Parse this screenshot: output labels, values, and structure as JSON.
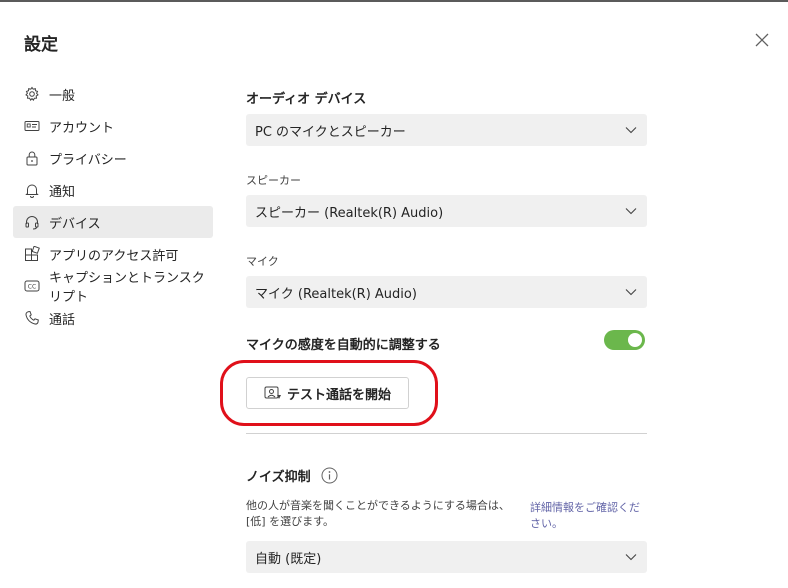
{
  "header": {
    "title": "設定"
  },
  "sidebar": {
    "items": [
      {
        "label": "一般",
        "icon": "gear-icon",
        "active": false
      },
      {
        "label": "アカウント",
        "icon": "id-card-icon",
        "active": false
      },
      {
        "label": "プライバシー",
        "icon": "lock-icon",
        "active": false
      },
      {
        "label": "通知",
        "icon": "bell-icon",
        "active": false
      },
      {
        "label": "デバイス",
        "icon": "headset-icon",
        "active": true
      },
      {
        "label": "アプリのアクセス許可",
        "icon": "apps-icon",
        "active": false
      },
      {
        "label": "キャプションとトランスクリプト",
        "icon": "cc-icon",
        "active": false
      },
      {
        "label": "通話",
        "icon": "phone-icon",
        "active": false
      }
    ]
  },
  "main": {
    "audio_devices": {
      "title": "オーディオ デバイス",
      "selected": "PC のマイクとスピーカー"
    },
    "speaker": {
      "label": "スピーカー",
      "selected": "スピーカー (Realtek(R) Audio)"
    },
    "mic": {
      "label": "マイク",
      "selected": "マイク (Realtek(R) Audio)"
    },
    "auto_adjust": {
      "label": "マイクの感度を自動的に調整する",
      "enabled": true
    },
    "test_call": {
      "label": "テスト通話を開始"
    },
    "noise": {
      "title": "ノイズ抑制",
      "description": "他の人が音楽を聞くことができるようにする場合は、[低] を選びます。",
      "link": "詳細情報をご確認ください。",
      "selected": "自動 (既定)"
    }
  },
  "colors": {
    "toggle_on": "#6bb74c",
    "highlight": "#e0101a",
    "link": "#6264a7"
  }
}
